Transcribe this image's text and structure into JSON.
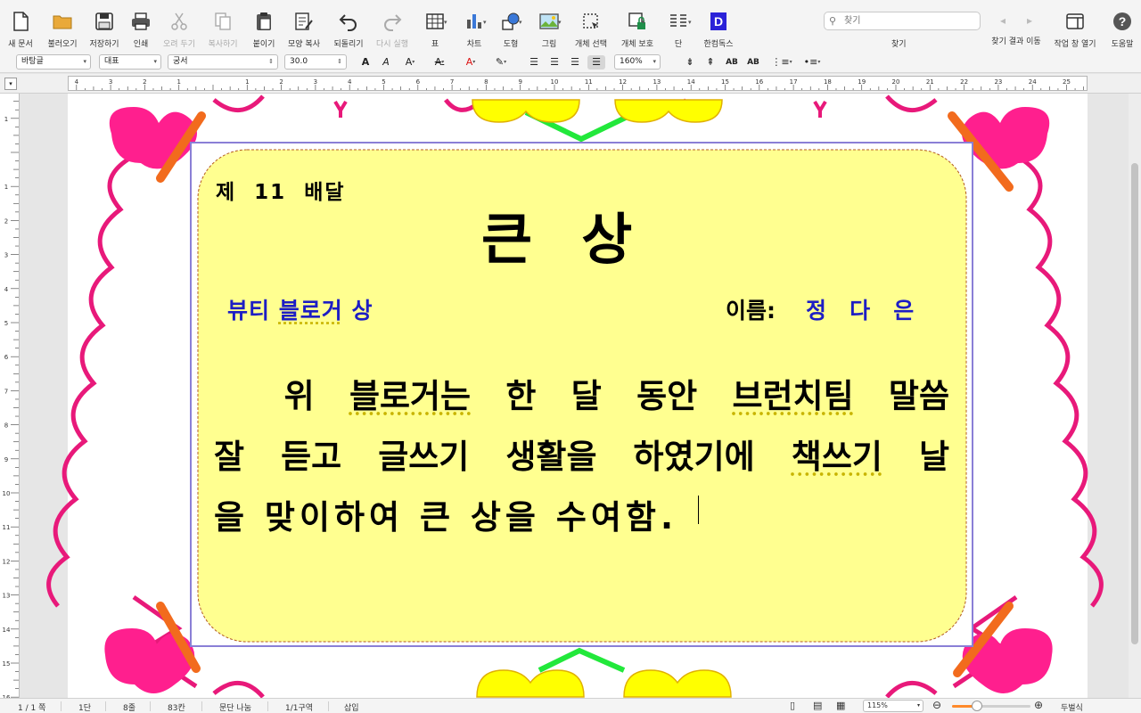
{
  "toolbar": {
    "new_doc": "새 문서",
    "open": "불러오기",
    "save": "저장하기",
    "print": "인쇄",
    "cut": "오려 두기",
    "copy": "복사하기",
    "paste": "붙이기",
    "format_copy": "모양 복사",
    "undo": "되돌리기",
    "redo": "다시 실행",
    "table": "표",
    "chart": "차트",
    "shape": "도형",
    "picture": "그림",
    "select_object": "개체 선택",
    "protect_object": "개체 보호",
    "column": "단",
    "hancom_docs": "한컴독스",
    "find": "찾기",
    "find_placeholder": "찾기",
    "find_next": "찾기 결과 이동",
    "task_pane": "작업 창 열기",
    "help": "도움말"
  },
  "formatbar": {
    "style": "바탕글",
    "language": "대표",
    "font": "궁서",
    "size": "30.0",
    "zoom": "160%"
  },
  "certificate": {
    "round_no": "제  11  배달",
    "title": "큰  상",
    "award_prefix": "뷰티 ",
    "award_spell": "블로거",
    "award_suffix": " 상",
    "name_label": "이름:",
    "name_value": "정   다   은",
    "line1_a": "  위 ",
    "line1_spell1": "블로거는",
    "line1_b": " 한 달 동안 ",
    "line1_spell2": "브런치팀",
    "line1_c": " 말씀",
    "line2_a": "잘 듣고 글쓰기 생활을 하였기에 ",
    "line2_spell": "책쓰기",
    "line2_b": " 날",
    "line3": "을 맞이하여 큰 상을 수여함."
  },
  "statusbar": {
    "page": "1 / 1 쪽",
    "column": "1단",
    "line": "8줄",
    "char": "83칸",
    "break": "문단 나눔",
    "section": "1/1구역",
    "mode": "삽입",
    "zoom": "115%",
    "zoom_level": 0.32,
    "view_mode": "두벌식"
  },
  "colors": {
    "frame_pink": "#e8197a",
    "heart": "#ff1f8e",
    "stick": "#f26b1d",
    "yellow": "#ffff00",
    "green": "#22e83b",
    "certificate_bg": "#ffff90",
    "border_purple": "#8a7fd6",
    "accent_blue": "#1d1dc4"
  }
}
